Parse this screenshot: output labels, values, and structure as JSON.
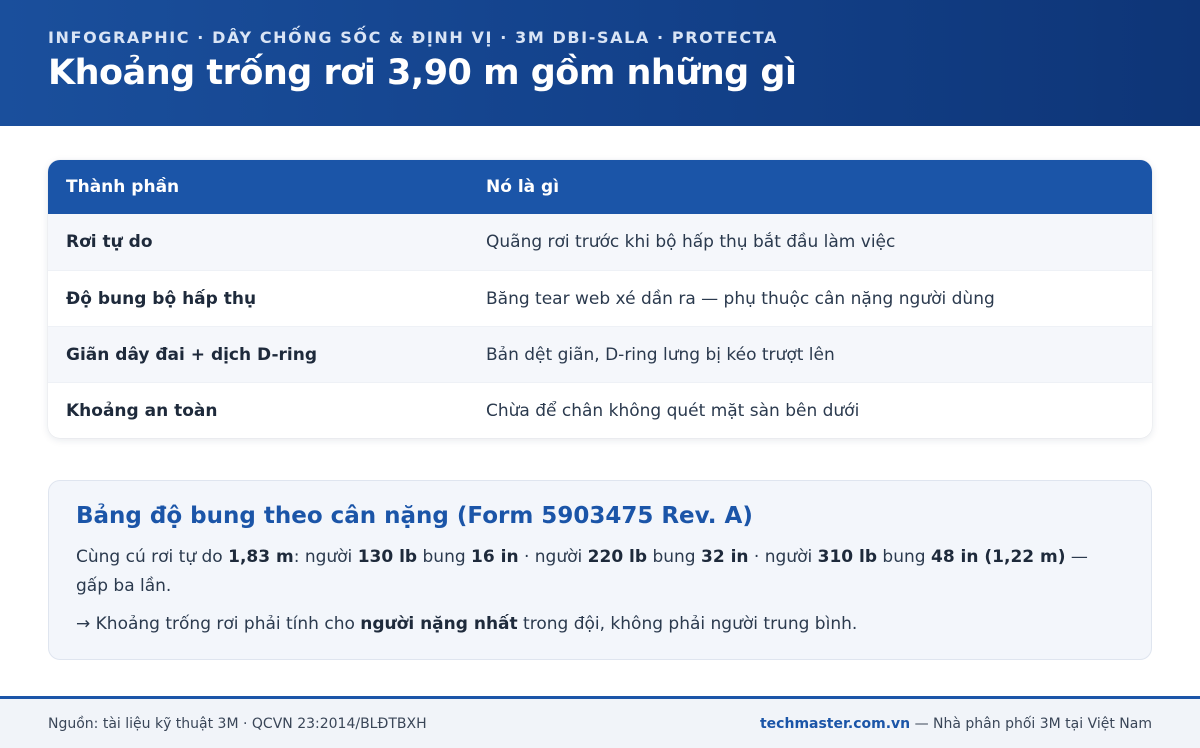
{
  "header": {
    "kicker": "INFOGRAPHIC · DÂY CHỐNG SỐC & ĐỊNH VỊ · 3M DBI-SALA · PROTECTA",
    "title": "Khoảng trống rơi 3,90 m gồm những gì"
  },
  "table": {
    "columns": [
      "Thành phần",
      "Nó là gì"
    ],
    "rows": [
      [
        "Rơi tự do",
        "Quãng rơi trước khi bộ hấp thụ bắt đầu làm việc"
      ],
      [
        "Độ bung bộ hấp thụ",
        "Băng tear web xé dần ra — phụ thuộc cân nặng người dùng"
      ],
      [
        "Giãn dây đai + dịch D-ring",
        "Bản dệt giãn, D-ring lưng bị kéo trượt lên"
      ],
      [
        "Khoảng an toàn",
        "Chừa để chân không quét mặt sàn bên dưới"
      ]
    ]
  },
  "note": {
    "title": "Bảng độ bung theo cân nặng (Form 5903475 Rev. A)",
    "p1": {
      "t1": "Cùng cú rơi tự do ",
      "b1": "1,83 m",
      "t2": ": người ",
      "b2": "130 lb",
      "t3": " bung ",
      "b3": "16 in",
      "t4": " · người ",
      "b4": "220 lb",
      "t5": " bung ",
      "b5": "32 in",
      "t6": " · người ",
      "b6": "310 lb",
      "t7": " bung ",
      "b7": "48 in (1,22 m)",
      "t8": " — gấp ba lần."
    },
    "p2": {
      "t1": "→ Khoảng trống rơi phải tính cho ",
      "b1": "người nặng nhất",
      "t2": " trong đội, không phải người trung bình."
    }
  },
  "footer": {
    "source": "Nguồn: tài liệu kỹ thuật 3M · QCVN 23:2014/BLĐTBXH",
    "brand": "techmaster.com.vn",
    "tagline": " — Nhà phân phối 3M tại Việt Nam"
  }
}
